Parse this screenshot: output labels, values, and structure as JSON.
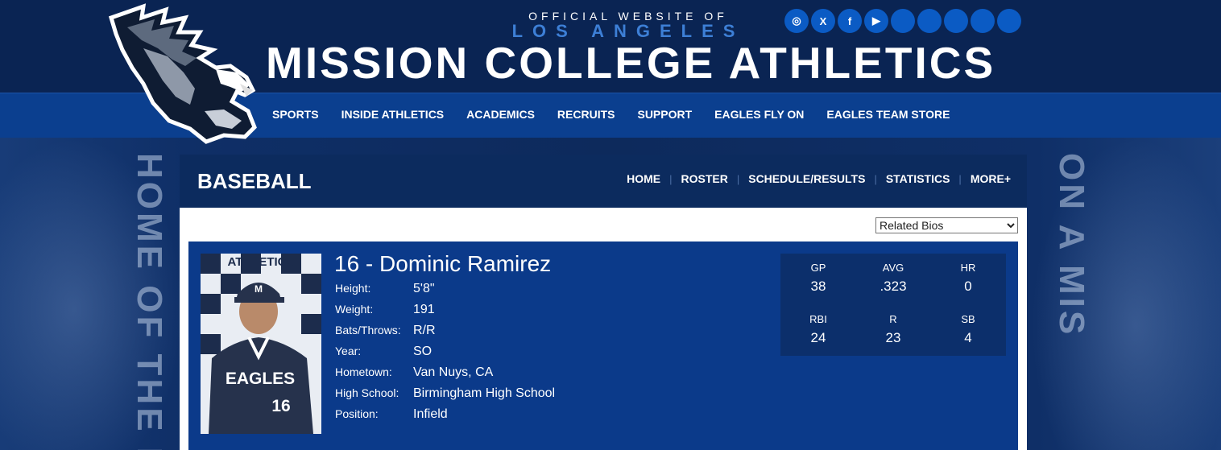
{
  "header": {
    "kicker": "OFFICIAL WEBSITE OF",
    "city": "LOS ANGELES",
    "title": "MISSION COLLEGE ATHLETICS",
    "social": [
      {
        "name": "instagram-icon",
        "glyph": "◎"
      },
      {
        "name": "x-icon",
        "glyph": "X"
      },
      {
        "name": "facebook-icon",
        "glyph": "f"
      },
      {
        "name": "youtube-icon",
        "glyph": "▶"
      },
      {
        "name": "social-icon-5",
        "glyph": ""
      },
      {
        "name": "social-icon-6",
        "glyph": ""
      },
      {
        "name": "social-icon-7",
        "glyph": ""
      },
      {
        "name": "social-icon-8",
        "glyph": ""
      },
      {
        "name": "social-icon-9",
        "glyph": ""
      }
    ],
    "nav": [
      "SPORTS",
      "INSIDE ATHLETICS",
      "ACADEMICS",
      "RECRUITS",
      "SUPPORT",
      "EAGLES FLY ON",
      "EAGLES TEAM STORE"
    ]
  },
  "background": {
    "left_text": "HOME OF THE EA",
    "right_text": "ON A MIS"
  },
  "sport": {
    "name": "BASEBALL",
    "nav": [
      "HOME",
      "ROSTER",
      "SCHEDULE/RESULTS",
      "STATISTICS",
      "MORE+"
    ]
  },
  "related_bios": {
    "selected": "Related Bios"
  },
  "player": {
    "title": "16 - Dominic Ramirez",
    "photo_text": {
      "banner": "ATHLETICS",
      "jersey": "EAGLES",
      "number": "16"
    },
    "facts": [
      {
        "label": "Height:",
        "value": "5'8\""
      },
      {
        "label": "Weight:",
        "value": "191"
      },
      {
        "label": "Bats/Throws:",
        "value": "R/R"
      },
      {
        "label": "Year:",
        "value": "SO"
      },
      {
        "label": "Hometown:",
        "value": "Van Nuys, CA"
      },
      {
        "label": "High School:",
        "value": "Birmingham High School"
      },
      {
        "label": "Position:",
        "value": "Infield"
      }
    ],
    "stats": [
      {
        "label": "GP",
        "value": "38"
      },
      {
        "label": "AVG",
        "value": ".323"
      },
      {
        "label": "HR",
        "value": "0"
      },
      {
        "label": "RBI",
        "value": "24"
      },
      {
        "label": "R",
        "value": "23"
      },
      {
        "label": "SB",
        "value": "4"
      }
    ]
  },
  "colors": {
    "header_dark": "#0a2453",
    "nav_blue": "#0b3f8f",
    "social_blue": "#0b5bc4",
    "bio_panel": "#0b3a8a",
    "stats_panel": "#0c2f6b",
    "accent_light_blue": "#3d7fd6"
  }
}
